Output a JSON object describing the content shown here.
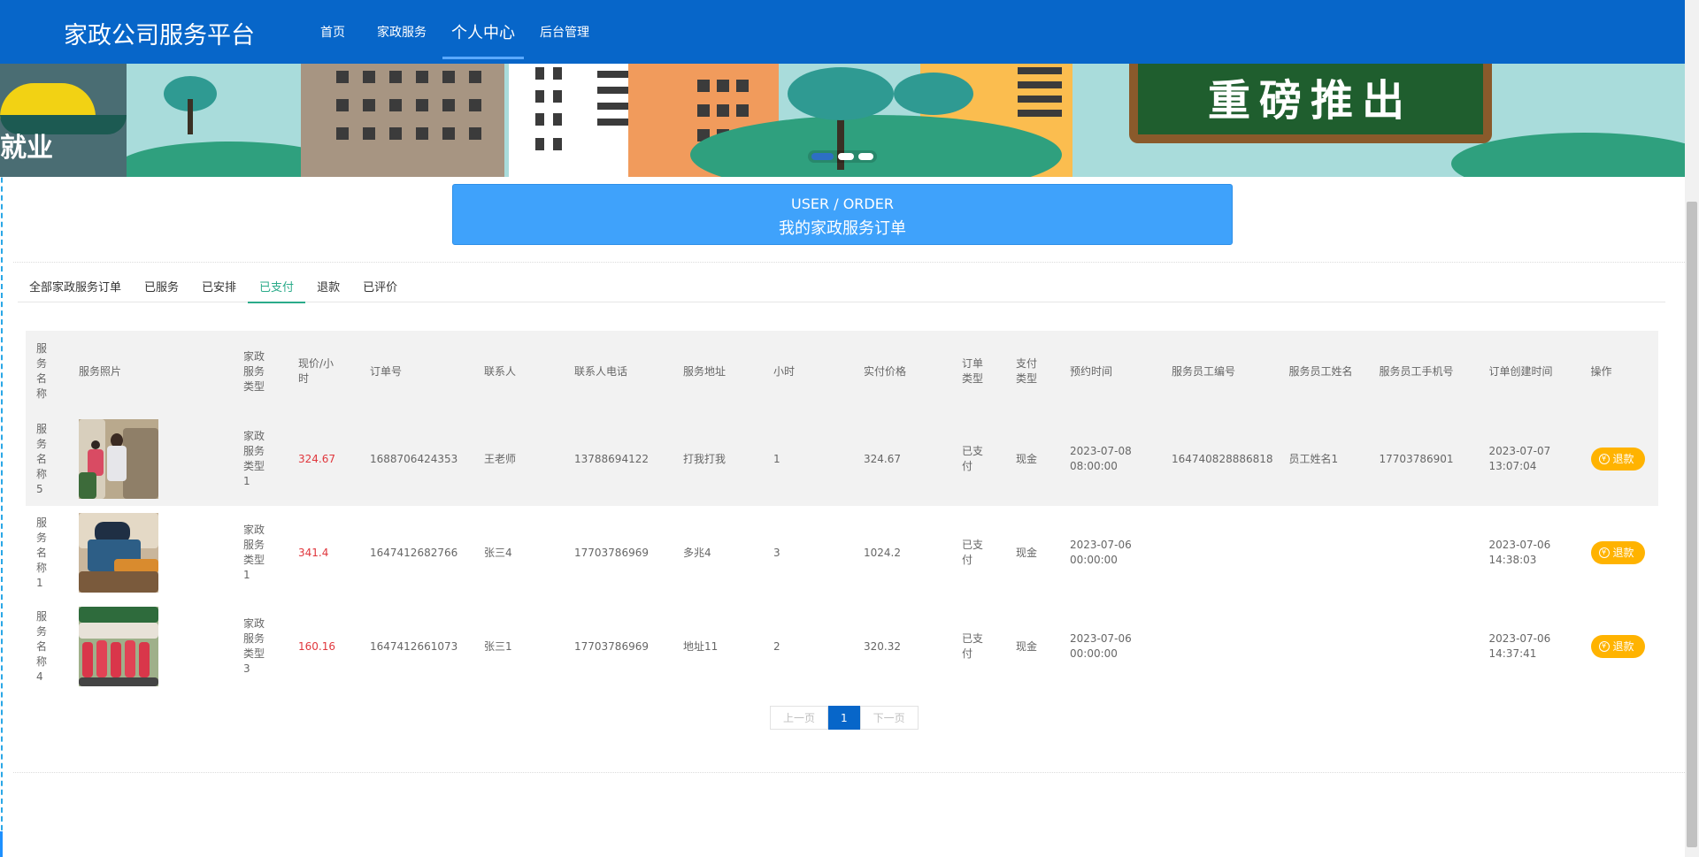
{
  "app": {
    "brand": "家政公司服务平台",
    "nav": [
      {
        "label": "首页"
      },
      {
        "label": "家政服务"
      },
      {
        "label": "个人中心",
        "active": true
      },
      {
        "label": "后台管理"
      }
    ]
  },
  "banner": {
    "left_text": "就业",
    "board_text": "重磅推出",
    "active_dot": 1,
    "dot_count": 3
  },
  "title": {
    "en": "USER / ORDER",
    "cn": "我的家政服务订单"
  },
  "tabs": [
    {
      "label": "全部家政服务订单"
    },
    {
      "label": "已服务"
    },
    {
      "label": "已安排"
    },
    {
      "label": "已支付",
      "active": true
    },
    {
      "label": "退款"
    },
    {
      "label": "已评价"
    }
  ],
  "table": {
    "headers": [
      "服务名称",
      "服务照片",
      "家政服务类型",
      "现价/小时",
      "订单号",
      "联系人",
      "联系人电话",
      "服务地址",
      "小时",
      "实付价格",
      "订单类型",
      "支付类型",
      "预约时间",
      "服务员工编号",
      "服务员工姓名",
      "服务员工手机号",
      "订单创建时间",
      "操作"
    ],
    "rows": [
      {
        "name": "服务名称5",
        "type": "家政服务类型1",
        "price": "324.67",
        "order_no": "1688706424353",
        "contact": "王老师",
        "phone": "13788694122",
        "address": "打我打我",
        "hours": "1",
        "paid": "324.67",
        "order_type": "已支付",
        "pay_type": "现金",
        "appt_date": "2023-07-08",
        "appt_time": "08:00:00",
        "staff_no": "164740828886818",
        "staff_name": "员工姓名1",
        "staff_phone": "17703786901",
        "created_date": "2023-07-07",
        "created_time": "13:07:04",
        "action": "退款"
      },
      {
        "name": "服务名称1",
        "type": "家政服务类型1",
        "price": "341.4",
        "order_no": "1647412682766",
        "contact": "张三4",
        "phone": "17703786969",
        "address": "多兆4",
        "hours": "3",
        "paid": "1024.2",
        "order_type": "已支付",
        "pay_type": "现金",
        "appt_date": "2023-07-06",
        "appt_time": "00:00:00",
        "staff_no": "",
        "staff_name": "",
        "staff_phone": "",
        "created_date": "2023-07-06",
        "created_time": "14:38:03",
        "action": "退款"
      },
      {
        "name": "服务名称4",
        "type": "家政服务类型3",
        "price": "160.16",
        "order_no": "1647412661073",
        "contact": "张三1",
        "phone": "17703786969",
        "address": "地址11",
        "hours": "2",
        "paid": "320.32",
        "order_type": "已支付",
        "pay_type": "现金",
        "appt_date": "2023-07-06",
        "appt_time": "00:00:00",
        "staff_no": "",
        "staff_name": "",
        "staff_phone": "",
        "created_date": "2023-07-06",
        "created_time": "14:37:41",
        "action": "退款"
      }
    ]
  },
  "pager": {
    "prev": "上一页",
    "current": "1",
    "next": "下一页"
  },
  "colors": {
    "header": "#0766c9",
    "title_box": "#3fa2fb",
    "tab_active": "#2bab8a",
    "price": "#e0373d",
    "refund_button": "#ffb300"
  },
  "icons": {
    "refund": "refund-icon"
  }
}
